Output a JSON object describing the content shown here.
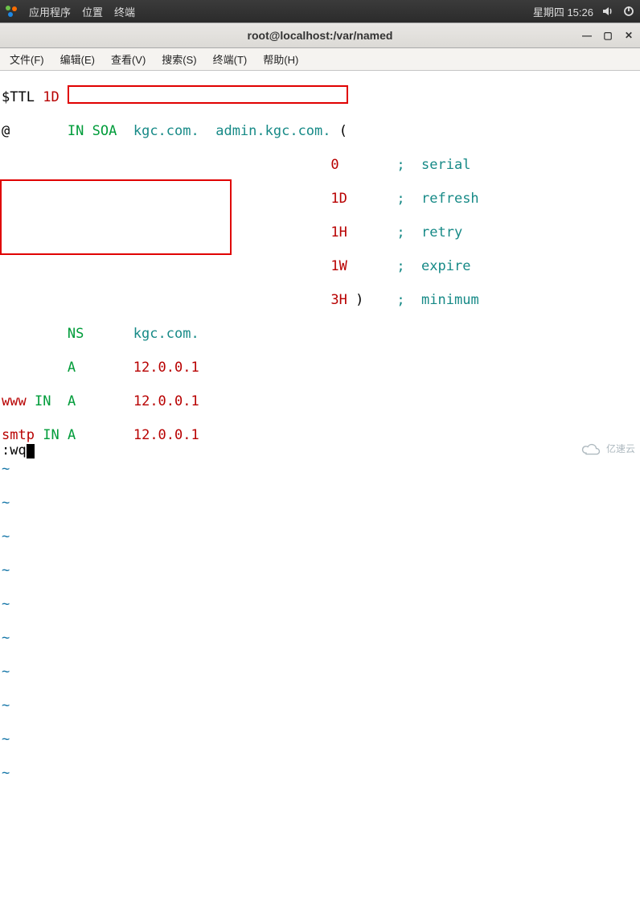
{
  "panel": {
    "apps": "应用程序",
    "places": "位置",
    "terminal": "终端",
    "clock": "星期四 15:26"
  },
  "window": {
    "title": "root@localhost:/var/named"
  },
  "menu": {
    "file": "文件(F)",
    "edit": "编辑(E)",
    "view": "查看(V)",
    "search": "搜索(S)",
    "terminal": "终端(T)",
    "help": "帮助(H)"
  },
  "zone": {
    "ttl_key": "$TTL",
    "ttl_val": "1D",
    "origin": "@",
    "in": "IN",
    "soa": "SOA",
    "mname": "kgc.com.",
    "rname": "admin.kgc.com.",
    "paren_open": "(",
    "paren_close": ")",
    "serial_v": "0",
    "serial_c": ";  serial",
    "refresh_v": "1D",
    "refresh_c": ";  refresh",
    "retry_v": "1H",
    "retry_c": ";  retry",
    "expire_v": "1W",
    "expire_c": ";  expire",
    "minimum_v": "3H",
    "minimum_c": ";  minimum",
    "ns": "NS",
    "ns_target": "kgc.com.",
    "a": "A",
    "ip": "12.0.0.1",
    "www": "www",
    "smtp": "smtp"
  },
  "tilde": "~",
  "vi": {
    "cmd": ":wq"
  },
  "watermark": "亿速云"
}
